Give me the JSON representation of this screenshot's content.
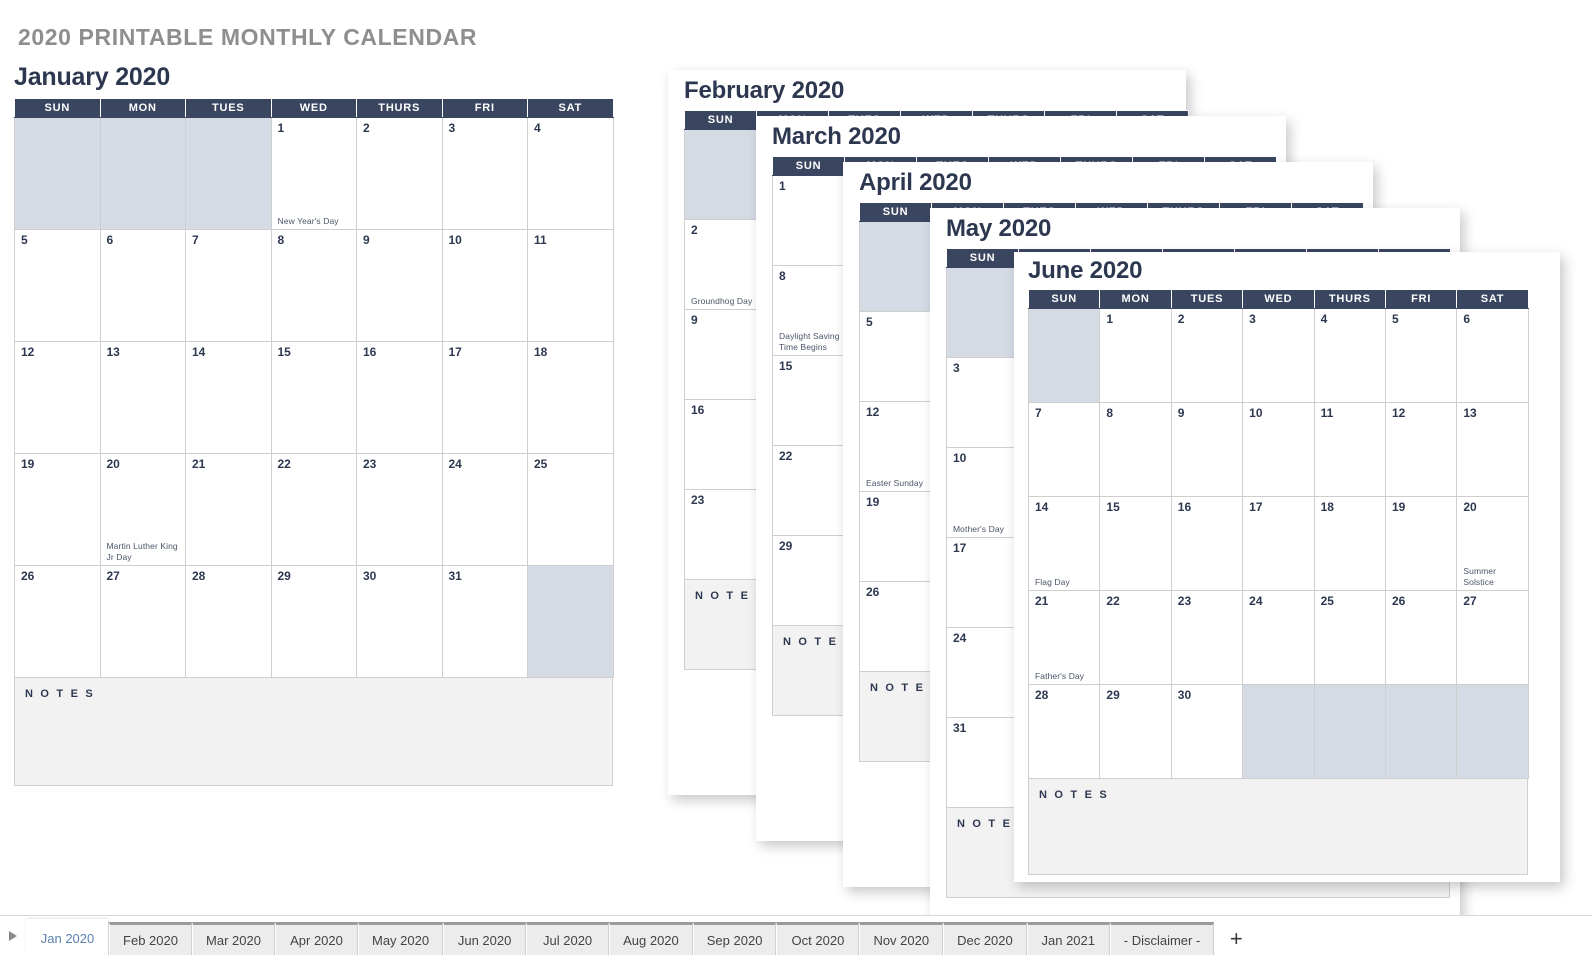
{
  "page_title": "2020 PRINTABLE MONTHLY CALENDAR",
  "weekday_headers": [
    "SUN",
    "MON",
    "TUES",
    "WED",
    "THURS",
    "FRI",
    "SAT"
  ],
  "notes_label": "N O T E S",
  "colors": {
    "header_navy": "#3a4660",
    "blank_cell": "#d4dbe5",
    "notes_bg": "#f2f2f2",
    "title_gray": "#8e8e8e",
    "active_tab_text": "#5b7fae",
    "grid_border": "#cfcfcf"
  },
  "months": {
    "january": {
      "title": "January 2020",
      "weeks": [
        [
          {
            "blank": true
          },
          {
            "blank": true
          },
          {
            "blank": true
          },
          {
            "day": "1",
            "holiday": "New Year's Day"
          },
          {
            "day": "2"
          },
          {
            "day": "3"
          },
          {
            "day": "4"
          }
        ],
        [
          {
            "day": "5"
          },
          {
            "day": "6"
          },
          {
            "day": "7"
          },
          {
            "day": "8"
          },
          {
            "day": "9"
          },
          {
            "day": "10"
          },
          {
            "day": "11"
          }
        ],
        [
          {
            "day": "12"
          },
          {
            "day": "13"
          },
          {
            "day": "14"
          },
          {
            "day": "15"
          },
          {
            "day": "16"
          },
          {
            "day": "17"
          },
          {
            "day": "18"
          }
        ],
        [
          {
            "day": "19"
          },
          {
            "day": "20",
            "holiday": "Martin Luther King Jr Day"
          },
          {
            "day": "21"
          },
          {
            "day": "22"
          },
          {
            "day": "23"
          },
          {
            "day": "24"
          },
          {
            "day": "25"
          }
        ],
        [
          {
            "day": "26"
          },
          {
            "day": "27"
          },
          {
            "day": "28"
          },
          {
            "day": "29"
          },
          {
            "day": "30"
          },
          {
            "day": "31"
          },
          {
            "blank": true
          }
        ]
      ]
    },
    "february": {
      "title": "February 2020",
      "sunday_column": [
        {
          "blank": true,
          "holiday": ""
        },
        {
          "day": "2",
          "holiday": "Groundhog Day"
        },
        {
          "day": "9"
        },
        {
          "day": "16"
        },
        {
          "day": "23"
        }
      ]
    },
    "march": {
      "title": "March 2020",
      "sunday_column": [
        {
          "day": "1"
        },
        {
          "day": "8",
          "holiday": "Daylight Saving Time Begins"
        },
        {
          "day": "15"
        },
        {
          "day": "22"
        },
        {
          "day": "29"
        }
      ]
    },
    "april": {
      "title": "April 2020",
      "sunday_column": [
        {
          "blank": true
        },
        {
          "day": "5"
        },
        {
          "day": "12",
          "holiday": "Easter Sunday"
        },
        {
          "day": "19"
        },
        {
          "day": "26"
        }
      ]
    },
    "may": {
      "title": "May 2020",
      "sunday_column": [
        {
          "blank": true
        },
        {
          "day": "3"
        },
        {
          "day": "10",
          "holiday": "Mother's Day"
        },
        {
          "day": "17"
        },
        {
          "day": "24"
        },
        {
          "day": "31"
        }
      ]
    },
    "june": {
      "title": "June 2020",
      "weeks": [
        [
          {
            "blank": true
          },
          {
            "day": "1"
          },
          {
            "day": "2"
          },
          {
            "day": "3"
          },
          {
            "day": "4"
          },
          {
            "day": "5"
          },
          {
            "day": "6"
          }
        ],
        [
          {
            "day": "7"
          },
          {
            "day": "8"
          },
          {
            "day": "9"
          },
          {
            "day": "10"
          },
          {
            "day": "11"
          },
          {
            "day": "12"
          },
          {
            "day": "13"
          }
        ],
        [
          {
            "day": "14",
            "holiday": "Flag Day"
          },
          {
            "day": "15"
          },
          {
            "day": "16"
          },
          {
            "day": "17"
          },
          {
            "day": "18"
          },
          {
            "day": "19"
          },
          {
            "day": "20",
            "holiday": "Summer Solstice"
          }
        ],
        [
          {
            "day": "21",
            "holiday": "Father's Day"
          },
          {
            "day": "22"
          },
          {
            "day": "23"
          },
          {
            "day": "24"
          },
          {
            "day": "25"
          },
          {
            "day": "26"
          },
          {
            "day": "27"
          }
        ],
        [
          {
            "day": "28"
          },
          {
            "day": "29"
          },
          {
            "day": "30"
          },
          {
            "blank": true
          },
          {
            "blank": true
          },
          {
            "blank": true
          },
          {
            "blank": true
          }
        ]
      ]
    }
  },
  "tabbar": {
    "scroll_arrow_icon": "triangle-right-icon",
    "add_sheet_label": "+",
    "active_tab": "Jan 2020",
    "tabs": [
      "Jan 2020",
      "Feb 2020",
      "Mar 2020",
      "Apr 2020",
      "May 2020",
      "Jun 2020",
      "Jul 2020",
      "Aug 2020",
      "Sep 2020",
      "Oct 2020",
      "Nov 2020",
      "Dec 2020",
      "Jan 2021",
      "- Disclaimer -"
    ]
  }
}
